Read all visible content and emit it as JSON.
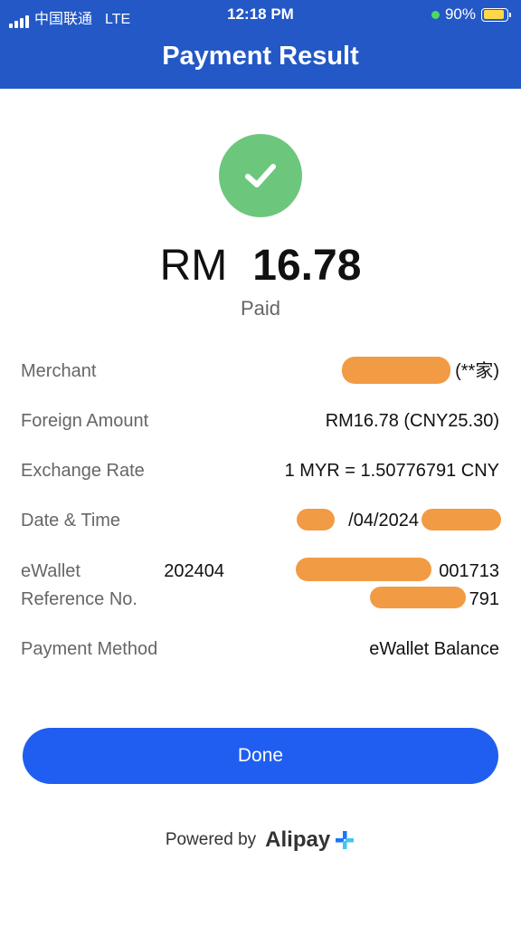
{
  "status_bar": {
    "carrier": "中国联通",
    "network": "LTE",
    "time": "12:18 PM",
    "battery": "90%"
  },
  "header": {
    "title": "Payment Result"
  },
  "result": {
    "currency": "RM",
    "amount": "16.78",
    "status": "Paid"
  },
  "details": [
    {
      "label": "Merchant",
      "value": "(**家)"
    },
    {
      "label": "Foreign Amount",
      "value": "RM16.78 (CNY25.30)"
    },
    {
      "label": "Exchange Rate",
      "value": "1 MYR = 1.50776791 CNY"
    },
    {
      "label": "Date & Time",
      "value": "/04/2024"
    },
    {
      "label": "eWallet",
      "label2": "Reference No.",
      "value": "202404",
      "value_tail": "001713",
      "value2": "791"
    },
    {
      "label": "Payment Method",
      "value": "eWallet Balance"
    }
  ],
  "done_button": {
    "label": "Done"
  },
  "footer": {
    "powered_by": "Powered by",
    "brand": "Alipay"
  },
  "colors": {
    "header": "#2358c6",
    "accent": "#1f5ef0",
    "success": "#6cc77c",
    "redaction": "#f0963a"
  }
}
